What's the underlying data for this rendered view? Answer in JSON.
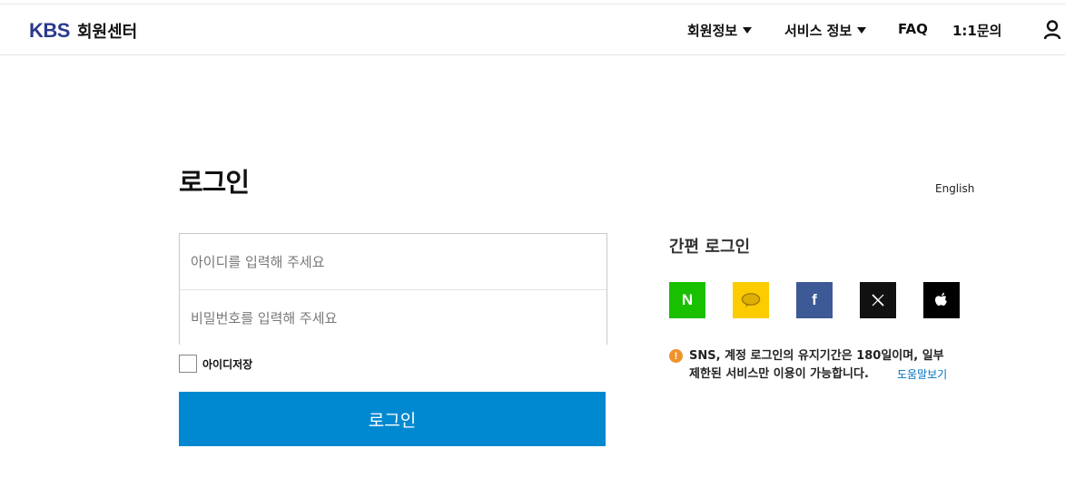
{
  "header": {
    "logo_kbs": "KBS",
    "logo_title": "회원센터",
    "nav": [
      {
        "label": "회원정보",
        "has_dropdown": true
      },
      {
        "label": "서비스 정보",
        "has_dropdown": true
      },
      {
        "label": "FAQ",
        "has_dropdown": false
      },
      {
        "label": "1:1문의",
        "has_dropdown": false
      }
    ],
    "user_icon": "user-icon"
  },
  "login": {
    "title": "로그인",
    "language_link": "English",
    "id_placeholder": "아이디를 입력해 주세요",
    "id_value": "",
    "password_placeholder": "비밀번호를 입력해 주세요",
    "password_value": "",
    "save_id_label": "아이디저장",
    "save_id_checked": false,
    "submit_label": "로그인"
  },
  "sns": {
    "title": "간편 로그인",
    "buttons": [
      {
        "name": "naver",
        "icon": "naver-icon",
        "color": "#19c000"
      },
      {
        "name": "kakao",
        "icon": "kakao-icon",
        "color": "#fccb00"
      },
      {
        "name": "facebook",
        "icon": "facebook-icon",
        "color": "#3d5996"
      },
      {
        "name": "x",
        "icon": "x-icon",
        "color": "#111111"
      },
      {
        "name": "apple",
        "icon": "apple-icon",
        "color": "#000000"
      }
    ],
    "notice_line1": "SNS, 계정 로그인의 유지기간은 180일이며, 일부",
    "notice_line2": "제한된 서비스만 이용이 가능합니다.",
    "help_link": "도움말보기"
  },
  "colors": {
    "brand": "#2b3a8c",
    "primary_button": "#0089d1",
    "notice_icon": "#f0922b",
    "link": "#0070c0"
  }
}
